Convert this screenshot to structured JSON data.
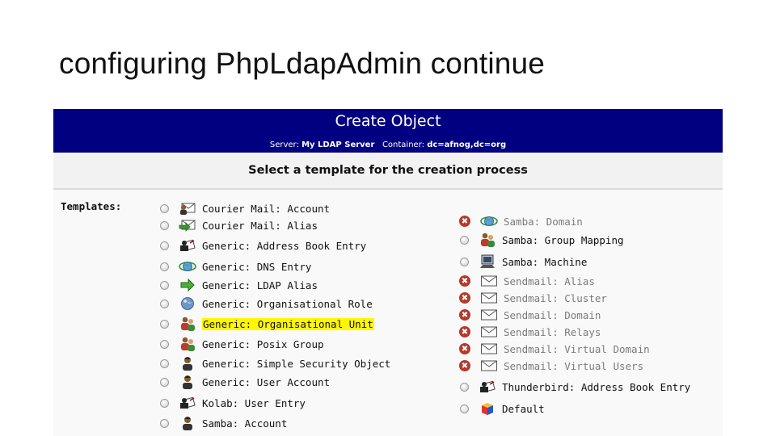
{
  "slide": {
    "title": "configuring PhpLdapAdmin continue"
  },
  "panel": {
    "title": "Create Object",
    "server_label": "Server:",
    "server_value": "My LDAP Server",
    "container_label": "Container:",
    "container_value": "dc=afnog,dc=org",
    "instruction": "Select a template for the creation process",
    "templates_label": "Templates:"
  },
  "colors": {
    "header_bg": "#000080",
    "highlight": "#fff700",
    "disabled_mark": "#b33a2a"
  },
  "templates_left": [
    {
      "label": "Courier Mail: Account",
      "icon": "user-mail-icon",
      "enabled": true
    },
    {
      "label": "Courier Mail: Alias",
      "icon": "mail-forward-icon",
      "enabled": true
    },
    {
      "label": "Generic: Address Book Entry",
      "icon": "address-book-icon",
      "enabled": true
    },
    {
      "label": "Generic: DNS Entry",
      "icon": "dns-globe-icon",
      "enabled": true
    },
    {
      "label": "Generic: LDAP Alias",
      "icon": "green-arrow-icon",
      "enabled": true
    },
    {
      "label": "Generic: Organisational Role",
      "icon": "globe-icon",
      "enabled": true
    },
    {
      "label": "Generic: Organisational Unit",
      "icon": "group-icon",
      "enabled": true,
      "highlighted": true
    },
    {
      "label": "Generic: Posix Group",
      "icon": "group-icon",
      "enabled": true
    },
    {
      "label": "Generic: Simple Security Object",
      "icon": "user-icon",
      "enabled": true
    },
    {
      "label": "Generic: User Account",
      "icon": "user-icon",
      "enabled": true
    },
    {
      "label": "Kolab: User Entry",
      "icon": "address-book-icon",
      "enabled": true
    },
    {
      "label": "Samba: Account",
      "icon": "user-icon",
      "enabled": true
    }
  ],
  "templates_right": [
    {
      "label": "Samba: Domain",
      "icon": "dns-globe-icon",
      "enabled": false
    },
    {
      "label": "Samba: Group Mapping",
      "icon": "group-icon",
      "enabled": true
    },
    {
      "label": "Samba: Machine",
      "icon": "computer-icon",
      "enabled": true
    },
    {
      "label": "Sendmail: Alias",
      "icon": "envelope-icon",
      "enabled": false
    },
    {
      "label": "Sendmail: Cluster",
      "icon": "envelope-icon",
      "enabled": false
    },
    {
      "label": "Sendmail: Domain",
      "icon": "envelope-icon",
      "enabled": false
    },
    {
      "label": "Sendmail: Relays",
      "icon": "envelope-icon",
      "enabled": false
    },
    {
      "label": "Sendmail: Virtual Domain",
      "icon": "envelope-icon",
      "enabled": false
    },
    {
      "label": "Sendmail: Virtual Users",
      "icon": "envelope-icon",
      "enabled": false
    },
    {
      "label": "Thunderbird: Address Book Entry",
      "icon": "address-book-icon",
      "enabled": true
    },
    {
      "label": "Default",
      "icon": "default-object-icon",
      "enabled": true
    }
  ]
}
